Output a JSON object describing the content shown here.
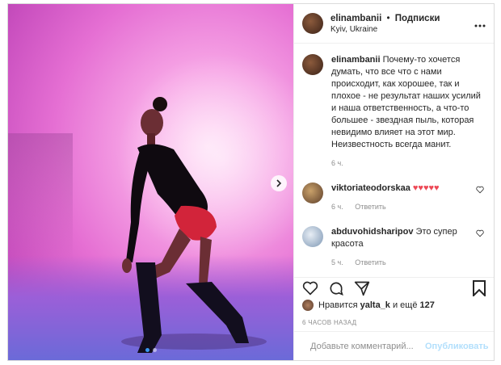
{
  "post": {
    "author": {
      "username": "elinambanii",
      "separator": "•",
      "follow_label": "Подписки",
      "location": "Kyiv, Ukraine",
      "more_icon": "more-horizontal-icon"
    },
    "caption": {
      "username": "elinambanii",
      "text": "Почему-то хочется думать, что все что с нами происходит, как хорошее, так и плохое - не результат наших усилий и наша ответственность, а что-то большее - звездная пыль, которая невидимо влияет на этот мир. Неизвестность всегда манит.",
      "time": "6 ч."
    },
    "comments": [
      {
        "username": "viktoriateodorskaa",
        "text": "♥♥♥♥♥",
        "time": "6 ч.",
        "reply_label": "Ответить"
      },
      {
        "username": "abduvohidsharipov",
        "text": "Это супер красота",
        "time": "5 ч.",
        "reply_label": "Ответить"
      }
    ],
    "likes": {
      "prefix": "Нравится",
      "user": "yalta_k",
      "middle": "и ещё",
      "count": "127"
    },
    "timestamp": "6 ЧАСОВ НАЗАД",
    "add_comment": {
      "placeholder": "Добавьте комментарий...",
      "publish_label": "Опубликовать"
    },
    "carousel": {
      "slide_count": 2,
      "active_index": 0
    }
  },
  "colors": {
    "link_blue": "#3897f0",
    "publish_disabled": "#b2dffc",
    "heart_red": "#ed4956",
    "muted_text": "#8e8e8e"
  }
}
